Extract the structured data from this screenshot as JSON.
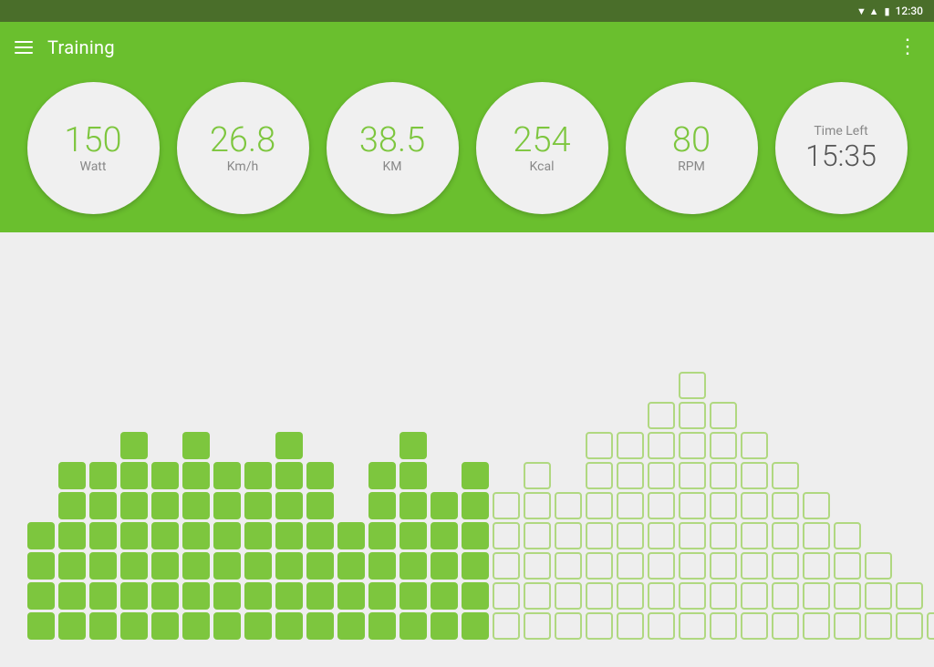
{
  "status_bar": {
    "time": "12:30",
    "signal_icon": "▼",
    "network_icon": "▲",
    "battery_icon": "▮"
  },
  "toolbar": {
    "title": "Training",
    "menu_icon": "menu",
    "more_icon": "⋮"
  },
  "metrics": [
    {
      "id": "watt",
      "value": "150",
      "unit": "Watt"
    },
    {
      "id": "speed",
      "value": "26.8",
      "unit": "Km/h"
    },
    {
      "id": "distance",
      "value": "38.5",
      "unit": "KM"
    },
    {
      "id": "kcal",
      "value": "254",
      "unit": "Kcal"
    },
    {
      "id": "rpm",
      "value": "80",
      "unit": "RPM"
    },
    {
      "id": "time",
      "label": "Time Left",
      "value": "15:35"
    }
  ],
  "chart": {
    "columns": [
      4,
      6,
      6,
      7,
      6,
      7,
      6,
      6,
      7,
      6,
      4,
      6,
      7,
      5,
      6,
      5,
      6,
      5,
      7,
      7,
      8,
      9,
      8,
      7,
      6,
      5,
      4,
      3,
      2,
      1
    ],
    "filled_count": 15,
    "accent_color": "#7dc63e",
    "outline_color": "#b0d880"
  }
}
